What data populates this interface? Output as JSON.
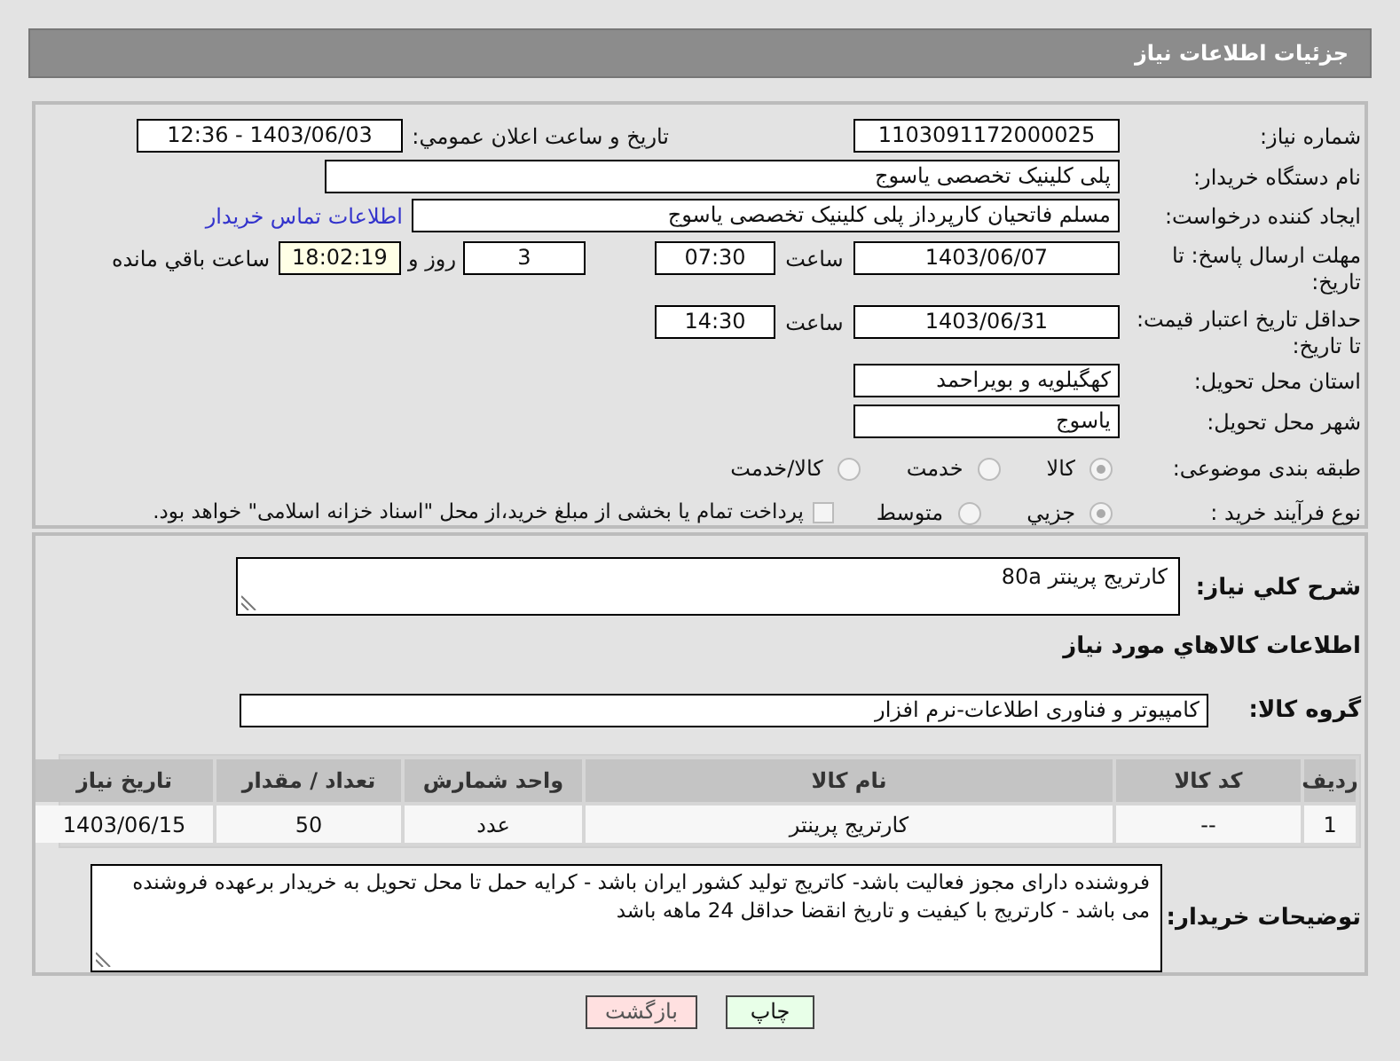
{
  "header": {
    "title": "جزئیات اطلاعات نیاز"
  },
  "need_number": {
    "label": "شماره نیاز:",
    "value": "1103091172000025"
  },
  "announce": {
    "label": "تاریخ و ساعت اعلان عمومي:",
    "value": "1403/06/03 - 12:36"
  },
  "buyer_org": {
    "label": "نام دستگاه خریدار:",
    "value": "پلی کلینیک تخصصی یاسوج"
  },
  "requester": {
    "label": "ایجاد کننده درخواست:",
    "value": "مسلم فاتحیان کارپرداز  پلی کلینیک تخصصی یاسوج",
    "link": "اطلاعات تماس خریدار"
  },
  "reply_deadline": {
    "label": "مهلت ارسال پاسخ: تا تاریخ:",
    "date": "1403/06/07",
    "time_label": "ساعت",
    "time": "07:30",
    "days": "3",
    "days_label": "روز و",
    "remaining": "18:02:19",
    "remaining_label": "ساعت باقي مانده"
  },
  "price_validity": {
    "label": "حداقل تاریخ اعتبار قیمت: تا تاریخ:",
    "date": "1403/06/31",
    "time_label": "ساعت",
    "time": "14:30"
  },
  "province": {
    "label": "استان محل تحویل:",
    "value": "کهگیلویه و بویراحمد"
  },
  "city": {
    "label": "شهر محل تحویل:",
    "value": "یاسوج"
  },
  "category": {
    "label": "طبقه بندی موضوعی:",
    "options": [
      {
        "label": "کالا",
        "selected": true
      },
      {
        "label": "خدمت",
        "selected": false
      },
      {
        "label": "کالا/خدمت",
        "selected": false
      }
    ]
  },
  "process": {
    "label": "نوع فرآیند خرید :",
    "options": [
      {
        "label": "جزیي",
        "selected": true
      },
      {
        "label": "متوسط",
        "selected": false
      }
    ],
    "payment": {
      "label": "پرداخت تمام یا بخشی از مبلغ خرید،از محل \"اسناد خزانه اسلامی\" خواهد بود.",
      "checked": false
    }
  },
  "description": {
    "label": "شرح کلي نیاز:",
    "value": "کارتریج پرینتر 80a"
  },
  "items_heading": "اطلاعات کالاهاي مورد نیاز",
  "goods_group": {
    "label": "گروه کالا:",
    "value": "کامپیوتر و فناوری اطلاعات-نرم افزار"
  },
  "table": {
    "columns": [
      "ردیف",
      "کد کالا",
      "نام کالا",
      "واحد شمارش",
      "تعداد / مقدار",
      "تاریخ نیاز"
    ],
    "rows": [
      [
        "1",
        "--",
        "کارتریج پرینتر",
        "عدد",
        "50",
        "1403/06/15"
      ]
    ]
  },
  "buyer_notes": {
    "label": "توضیحات خریدار:",
    "value": "فروشنده دارای مجوز فعالیت باشد- کاتریج تولید کشور ایران باشد - کرایه حمل تا محل تحویل به خریدار برعهده فروشنده می باشد - کارتریج با کیفیت و تاریخ انقضا حداقل 24 ماهه باشد"
  },
  "buttons": [
    {
      "label": "چاپ",
      "kind": "print"
    },
    {
      "label": "بازگشت",
      "kind": "back"
    }
  ]
}
